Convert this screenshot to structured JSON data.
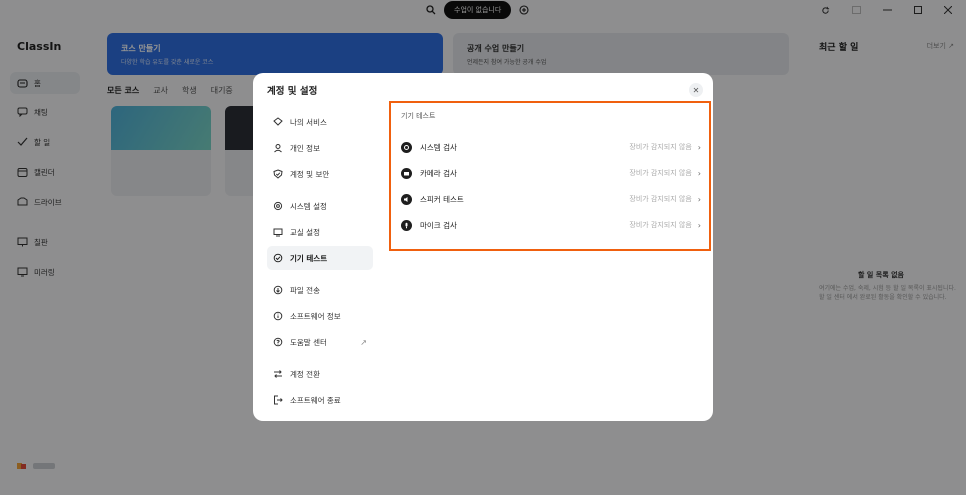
{
  "titlebar": {
    "pill": "수업이 없습니다"
  },
  "sidebar": {
    "logo": "ClassIn",
    "items": [
      {
        "label": "홈",
        "icon": "home-icon"
      },
      {
        "label": "채팅",
        "icon": "chat-icon"
      },
      {
        "label": "할 일",
        "icon": "check-icon"
      },
      {
        "label": "캘린더",
        "icon": "calendar-icon"
      },
      {
        "label": "드라이브",
        "icon": "drive-icon"
      },
      {
        "label": "칠판",
        "icon": "board-icon"
      },
      {
        "label": "미러링",
        "icon": "mirror-icon"
      }
    ]
  },
  "main": {
    "banner1": {
      "title": "코스 만들기",
      "sub": "다양한 학습 유도를 갖춘 새로운 코스"
    },
    "banner2": {
      "title": "공개 수업 만들기",
      "sub": "언제든지 참여 가능한 공개 수업"
    },
    "tabs": [
      "모든 코스",
      "교사",
      "학생",
      "대기중"
    ]
  },
  "right_panel": {
    "title": "최근 할 일",
    "more": "더보기 ↗",
    "empty": "할 일 목록 없음",
    "desc": "여기에는 수업, 숙제, 시험 등 할 일 목록이 표시됩니다. 할 일 센터 에서 완료된 활동을 확인할 수 있습니다."
  },
  "modal": {
    "title": "계정 및 설정",
    "close": "✕",
    "menu": [
      {
        "label": "나의 서비스",
        "icon": "service-icon"
      },
      {
        "label": "개인 정보",
        "icon": "user-icon"
      },
      {
        "label": "계정 및 보안",
        "icon": "shield-icon"
      },
      {
        "label": "시스템 설정",
        "icon": "gear-icon"
      },
      {
        "label": "교실 설정",
        "icon": "classroom-icon"
      },
      {
        "label": "기기 테스트",
        "icon": "device-test-icon"
      },
      {
        "label": "파일 전송",
        "icon": "file-transfer-icon"
      },
      {
        "label": "소프트웨어 정보",
        "icon": "info-icon"
      },
      {
        "label": "도움말 센터",
        "icon": "help-icon",
        "ext": "↗"
      },
      {
        "label": "계정 전환",
        "icon": "switch-icon"
      },
      {
        "label": "소프트웨어 종료",
        "icon": "exit-icon"
      }
    ],
    "section_title": "기기 테스트",
    "rows": [
      {
        "label": "시스템 검사",
        "status": "장비가 감지되지 않음",
        "icon": "system-icon"
      },
      {
        "label": "카메라 검사",
        "status": "장비가 감지되지 않음",
        "icon": "camera-icon"
      },
      {
        "label": "스피커 테스트",
        "status": "장비가 감지되지 않음",
        "icon": "speaker-icon"
      },
      {
        "label": "마이크 검사",
        "status": "장비가 감지되지 않음",
        "icon": "mic-icon"
      }
    ],
    "accent": "#f0600e"
  }
}
